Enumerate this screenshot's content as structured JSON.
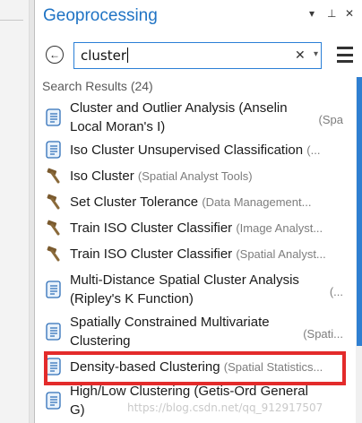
{
  "pane": {
    "title": "Geoprocessing",
    "controls": {
      "options": "▾",
      "pin": "⊥",
      "close": "✕"
    }
  },
  "search": {
    "back_icon": "arrow-left-circle-icon",
    "value": "cluster",
    "clear": "✕",
    "dropdown": "▾"
  },
  "results_header": "Search Results (24)",
  "results": [
    {
      "name": "Cluster and Outlier Analysis (Anselin",
      "name2": "Local Moran's I)",
      "toolbox": "(Spa",
      "icon": "script-tool-icon"
    },
    {
      "name": "Iso Cluster Unsupervised Classification",
      "toolbox": "(...",
      "icon": "script-tool-icon"
    },
    {
      "name": "Iso Cluster",
      "toolbox": "(Spatial Analyst Tools)",
      "icon": "hammer-tool-icon"
    },
    {
      "name": "Set Cluster Tolerance",
      "toolbox": "(Data Management...",
      "icon": "hammer-tool-icon"
    },
    {
      "name": "Train ISO Cluster Classifier",
      "toolbox": "(Image Analyst...",
      "icon": "hammer-tool-icon"
    },
    {
      "name": "Train ISO Cluster Classifier",
      "toolbox": "(Spatial Analyst...",
      "icon": "hammer-tool-icon"
    },
    {
      "name": "Multi-Distance Spatial Cluster Analysis",
      "name2": "(Ripley's K Function)",
      "toolbox": "(...",
      "icon": "script-tool-icon"
    },
    {
      "name": "Spatially Constrained Multivariate",
      "name2": "Clustering",
      "toolbox": "(Spati...",
      "icon": "script-tool-icon"
    },
    {
      "name": "Density-based Clustering",
      "toolbox": "(Spatial Statistics...",
      "icon": "script-tool-icon"
    },
    {
      "name": "High/Low Clustering (Getis-Ord General",
      "name2": "G)",
      "toolbox": "",
      "icon": "script-tool-icon"
    }
  ],
  "watermark": "https://blog.csdn.net/qq_912917507",
  "colors": {
    "accent": "#1f73c4",
    "highlight": "#e32b2b",
    "scroll": "#2f7fd1"
  }
}
